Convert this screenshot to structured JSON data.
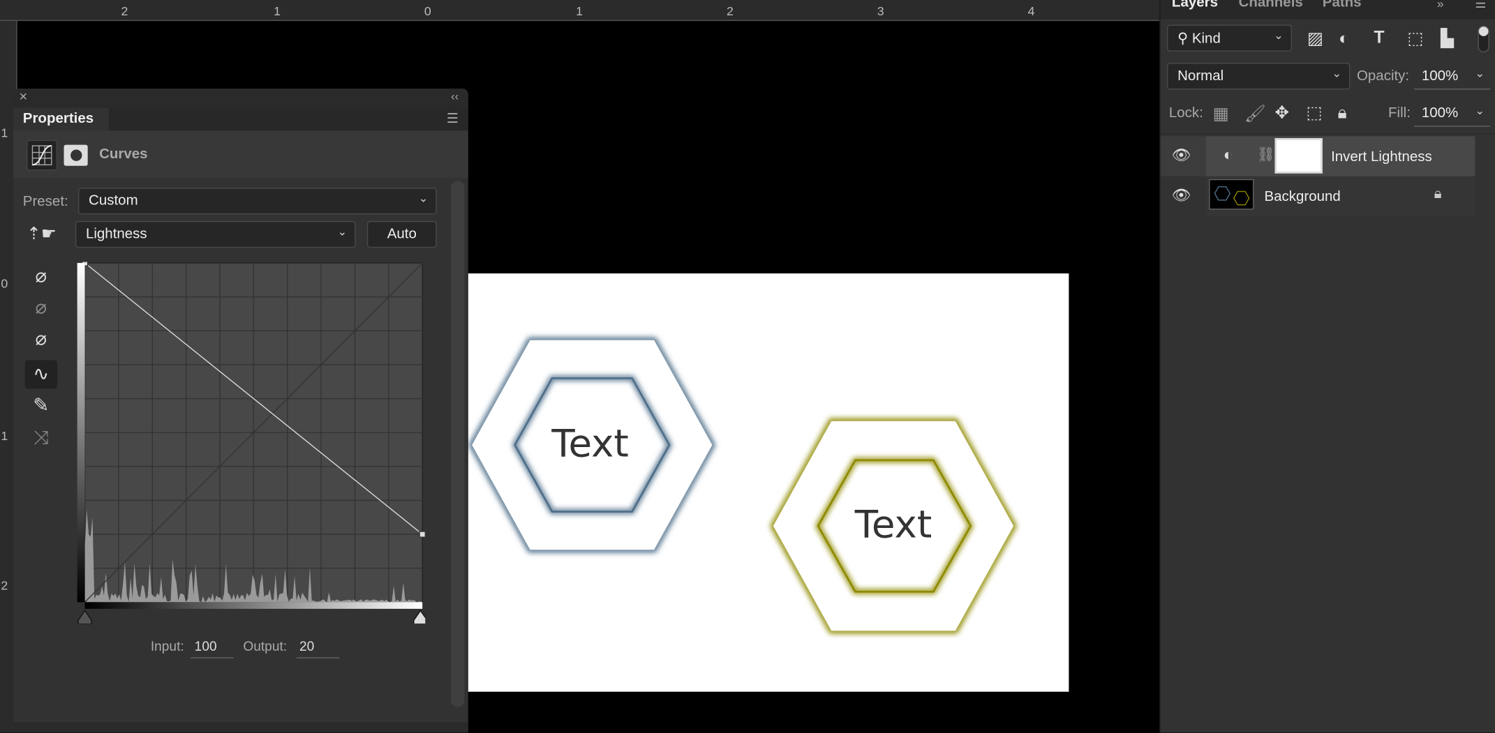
{
  "rulers": {
    "top_labels": [
      "2",
      "1",
      "0",
      "1",
      "2",
      "3",
      "4"
    ],
    "left_labels": [
      "1",
      "0",
      "1",
      "2"
    ]
  },
  "properties": {
    "title": "Properties",
    "adjustment": "Curves",
    "preset_label": "Preset:",
    "preset_value": "Custom",
    "channel_value": "Lightness",
    "auto_label": "Auto",
    "input_label": "Input:",
    "input_value": "100",
    "output_label": "Output:",
    "output_value": "20",
    "curve_points": [
      [
        0,
        100
      ],
      [
        100,
        20
      ]
    ],
    "curve_range": [
      0,
      100
    ]
  },
  "canvas": {
    "shapes": [
      {
        "label": "Text",
        "color": "#4f6f8a"
      },
      {
        "label": "Text",
        "color": "#8f8a00"
      }
    ]
  },
  "layers_panel": {
    "tabs": [
      "Layers",
      "Channels",
      "Paths"
    ],
    "filter_kind": "Kind",
    "blend_mode": "Normal",
    "opacity_label": "Opacity:",
    "opacity_value": "100%",
    "lock_label": "Lock:",
    "fill_label": "Fill:",
    "fill_value": "100%",
    "layers": [
      {
        "name": "Invert Lightness",
        "type": "adjustment",
        "visible": true,
        "selected": true
      },
      {
        "name": "Background",
        "type": "pixel",
        "visible": true,
        "locked": true
      }
    ]
  }
}
